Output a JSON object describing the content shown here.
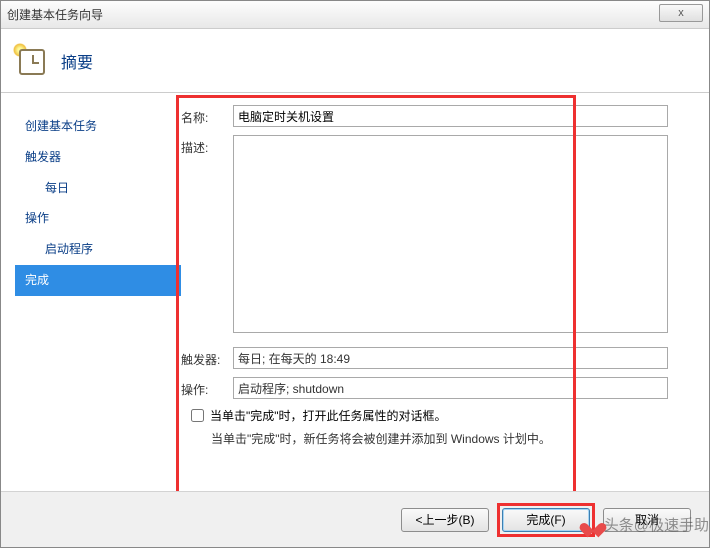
{
  "window": {
    "title": "创建基本任务向导",
    "close_label": "x"
  },
  "header": {
    "title": "摘要"
  },
  "sidebar": {
    "items": [
      {
        "label": "创建基本任务",
        "indent": false,
        "selected": false
      },
      {
        "label": "触发器",
        "indent": false,
        "selected": false
      },
      {
        "label": "每日",
        "indent": true,
        "selected": false
      },
      {
        "label": "操作",
        "indent": false,
        "selected": false
      },
      {
        "label": "启动程序",
        "indent": true,
        "selected": false
      },
      {
        "label": "完成",
        "indent": false,
        "selected": true
      }
    ]
  },
  "form": {
    "name_label": "名称:",
    "name_value": "电脑定时关机设置",
    "desc_label": "描述:",
    "desc_value": "",
    "trigger_label": "触发器:",
    "trigger_value": "每日; 在每天的 18:49",
    "action_label": "操作:",
    "action_value": "启动程序; shutdown",
    "checkbox_label": "当单击\"完成\"时，打开此任务属性的对话框。",
    "hint_text": "当单击\"完成\"时，新任务将会被创建并添加到 Windows 计划中。"
  },
  "footer": {
    "back_label": "<上一步(B)",
    "finish_label": "完成(F)",
    "cancel_label": "取消"
  },
  "watermark": {
    "text": "头条@极速手助"
  }
}
